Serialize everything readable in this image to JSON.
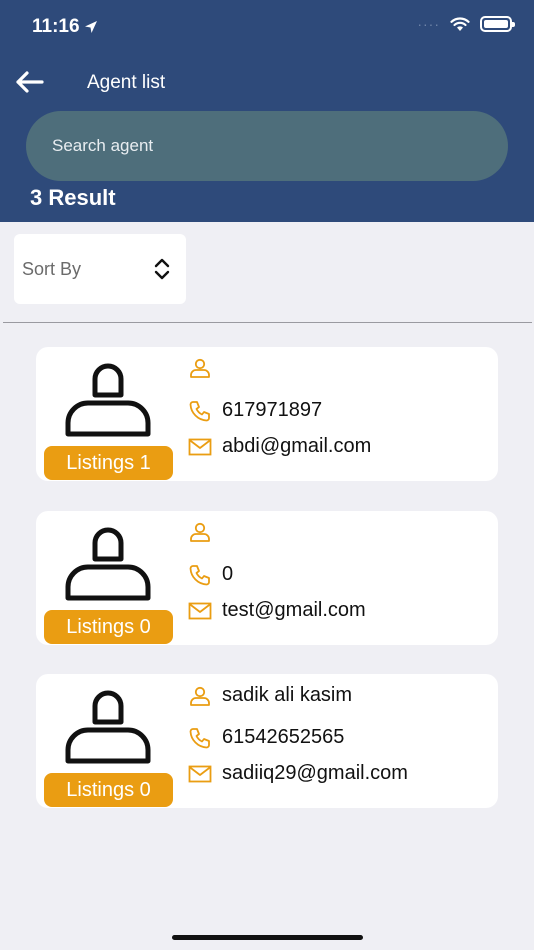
{
  "status_bar": {
    "time": "11:16",
    "dots": "····"
  },
  "nav": {
    "title": "Agent list"
  },
  "search": {
    "placeholder": "Search agent"
  },
  "results": {
    "count_label": "3 Result"
  },
  "sort": {
    "label": "Sort By"
  },
  "colors": {
    "header": "#2e4a7a",
    "accent": "#ea9d12",
    "search_bg": "#4e6e7b"
  },
  "agents": [
    {
      "name": "",
      "phone": "617971897",
      "email": "abdi@gmail.com",
      "listings_label": "Listings 1"
    },
    {
      "name": "",
      "phone": "0",
      "email": "test@gmail.com",
      "listings_label": "Listings 0"
    },
    {
      "name": "sadik ali kasim",
      "phone": "61542652565",
      "email": "sadiiq29@gmail.com",
      "listings_label": "Listings 0"
    }
  ]
}
